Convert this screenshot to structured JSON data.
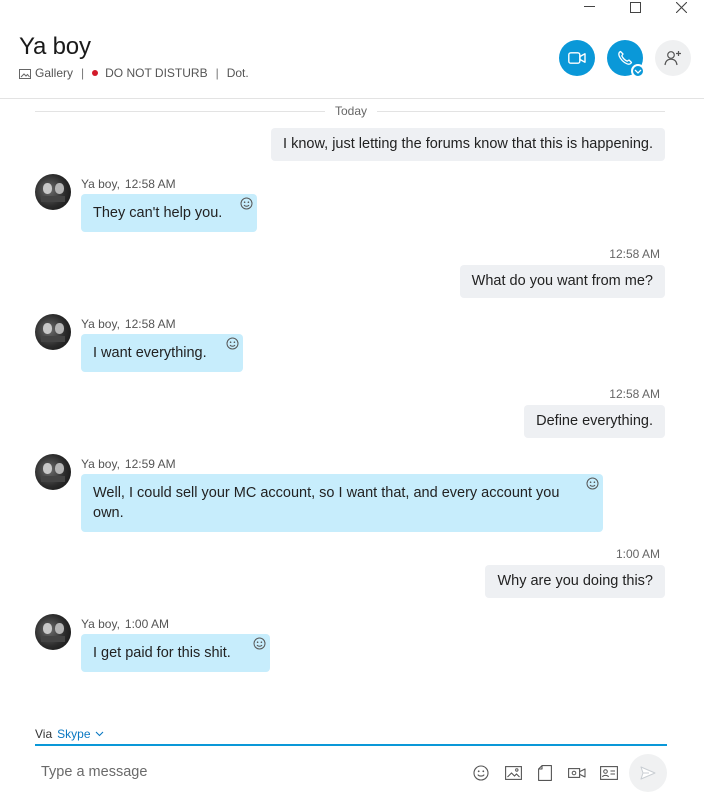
{
  "window": {
    "controls": [
      "minimize",
      "maximize",
      "close"
    ]
  },
  "header": {
    "title": "Ya boy",
    "gallery_label": "Gallery",
    "status_label": "DO NOT DISTURB",
    "status_color": "#d21a2a",
    "extra_label": "Dot.",
    "accent_color": "#0a98d8"
  },
  "feed": {
    "day_separator": "Today",
    "messages": [
      {
        "direction": "out",
        "text": "I know, just letting the forums know that this is happening."
      },
      {
        "direction": "in",
        "sender": "Ya boy,",
        "time": "12:58 AM",
        "text": "They can't help you."
      },
      {
        "direction": "out",
        "time": "12:58 AM",
        "text": "What do you want from me?"
      },
      {
        "direction": "in",
        "sender": "Ya boy,",
        "time": "12:58 AM",
        "text": "I want everything."
      },
      {
        "direction": "out",
        "time": "12:58 AM",
        "text": "Define everything."
      },
      {
        "direction": "in",
        "sender": "Ya boy,",
        "time": "12:59 AM",
        "text_line1": "Well, I could sell your MC account, so I want that, and every account you",
        "text_line2": "own."
      },
      {
        "direction": "out",
        "time": "1:00 AM",
        "text": "Why are you doing this?"
      },
      {
        "direction": "in",
        "sender": "Ya boy,",
        "time": "1:00 AM",
        "text": "I get paid for this shit."
      }
    ]
  },
  "composer": {
    "via_label": "Via",
    "via_service": "Skype",
    "placeholder": "Type a message",
    "tools": [
      "emoji-icon",
      "image-icon",
      "file-icon",
      "video-message-icon",
      "contact-card-icon"
    ]
  }
}
